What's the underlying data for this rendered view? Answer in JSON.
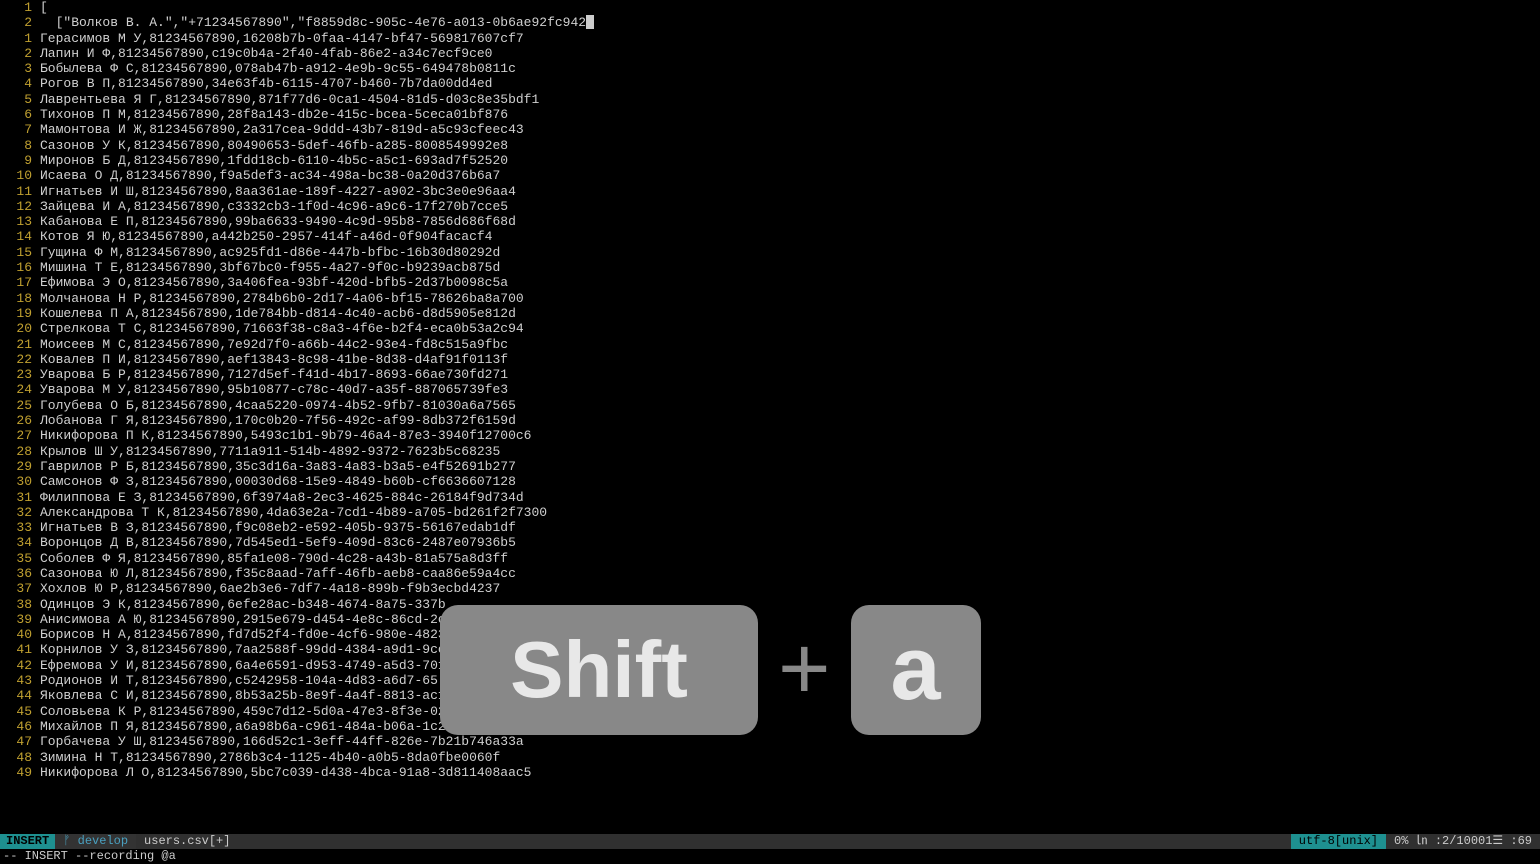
{
  "header_lines": [
    {
      "num": "1",
      "text": "["
    },
    {
      "num": "2",
      "text": "  [\"Волков В. А.\",\"+71234567890\",\"f8859d8c-905c-4e76-a013-0b6ae92fc942",
      "cursor": true
    }
  ],
  "lines": [
    {
      "num": "1",
      "text": "Герасимов М У,81234567890,16208b7b-0faa-4147-bf47-569817607cf7"
    },
    {
      "num": "2",
      "text": "Лапин И Ф,81234567890,c19c0b4a-2f40-4fab-86e2-a34c7ecf9ce0"
    },
    {
      "num": "3",
      "text": "Бобылева Ф С,81234567890,078ab47b-a912-4e9b-9c55-649478b0811c"
    },
    {
      "num": "4",
      "text": "Рогов В П,81234567890,34e63f4b-6115-4707-b460-7b7da00dd4ed"
    },
    {
      "num": "5",
      "text": "Лаврентьева Я Г,81234567890,871f77d6-0ca1-4504-81d5-d03c8e35bdf1"
    },
    {
      "num": "6",
      "text": "Тихонов П М,81234567890,28f8a143-db2e-415c-bcea-5ceca01bf876"
    },
    {
      "num": "7",
      "text": "Мамонтова И Ж,81234567890,2a317cea-9ddd-43b7-819d-a5c93cfeec43"
    },
    {
      "num": "8",
      "text": "Сазонов У К,81234567890,80490653-5def-46fb-a285-8008549992e8"
    },
    {
      "num": "9",
      "text": "Миронов Б Д,81234567890,1fdd18cb-6110-4b5c-a5c1-693ad7f52520"
    },
    {
      "num": "10",
      "text": "Исаева О Д,81234567890,f9a5def3-ac34-498a-bc38-0a20d376b6a7"
    },
    {
      "num": "11",
      "text": "Игнатьев И Ш,81234567890,8aa361ae-189f-4227-a902-3bc3e0e96aa4"
    },
    {
      "num": "12",
      "text": "Зайцева И А,81234567890,c3332cb3-1f0d-4c96-a9c6-17f270b7cce5"
    },
    {
      "num": "13",
      "text": "Кабанова Е П,81234567890,99ba6633-9490-4c9d-95b8-7856d686f68d"
    },
    {
      "num": "14",
      "text": "Котов Я Ю,81234567890,a442b250-2957-414f-a46d-0f904facacf4"
    },
    {
      "num": "15",
      "text": "Гущина Ф М,81234567890,ac925fd1-d86e-447b-bfbc-16b30d80292d"
    },
    {
      "num": "16",
      "text": "Мишина Т Е,81234567890,3bf67bc0-f955-4a27-9f0c-b9239acb875d"
    },
    {
      "num": "17",
      "text": "Ефимова Э О,81234567890,3a406fea-93bf-420d-bfb5-2d37b0098c5a"
    },
    {
      "num": "18",
      "text": "Молчанова Н Р,81234567890,2784b6b0-2d17-4a06-bf15-78626ba8a700"
    },
    {
      "num": "19",
      "text": "Кошелева П А,81234567890,1de784bb-d814-4c40-acb6-d8d5905e812d"
    },
    {
      "num": "20",
      "text": "Стрелкова Т С,81234567890,71663f38-c8a3-4f6e-b2f4-eca0b53a2c94"
    },
    {
      "num": "21",
      "text": "Моисеев М С,81234567890,7e92d7f0-a66b-44c2-93e4-fd8c515a9fbc"
    },
    {
      "num": "22",
      "text": "Ковалев П И,81234567890,aef13843-8c98-41be-8d38-d4af91f0113f"
    },
    {
      "num": "23",
      "text": "Уварова Б Р,81234567890,7127d5ef-f41d-4b17-8693-66ae730fd271"
    },
    {
      "num": "24",
      "text": "Уварова М У,81234567890,95b10877-c78c-40d7-a35f-887065739fe3"
    },
    {
      "num": "25",
      "text": "Голубева О Б,81234567890,4caa5220-0974-4b52-9fb7-81030a6a7565"
    },
    {
      "num": "26",
      "text": "Лобанова Г Я,81234567890,170c0b20-7f56-492c-af99-8db372f6159d"
    },
    {
      "num": "27",
      "text": "Никифорова П К,81234567890,5493c1b1-9b79-46a4-87e3-3940f12700c6"
    },
    {
      "num": "28",
      "text": "Крылов Ш У,81234567890,7711a911-514b-4892-9372-7623b5c68235"
    },
    {
      "num": "29",
      "text": "Гаврилов Р Б,81234567890,35c3d16a-3a83-4a83-b3a5-e4f52691b277"
    },
    {
      "num": "30",
      "text": "Самсонов Ф З,81234567890,00030d68-15e9-4849-b60b-cf6636607128"
    },
    {
      "num": "31",
      "text": "Филиппова Е З,81234567890,6f3974a8-2ec3-4625-884c-26184f9d734d"
    },
    {
      "num": "32",
      "text": "Александрова Т К,81234567890,4da63e2a-7cd1-4b89-a705-bd261f2f7300"
    },
    {
      "num": "33",
      "text": "Игнатьев В З,81234567890,f9c08eb2-e592-405b-9375-56167edab1df"
    },
    {
      "num": "34",
      "text": "Воронцов Д В,81234567890,7d545ed1-5ef9-409d-83c6-2487e07936b5"
    },
    {
      "num": "35",
      "text": "Соболев Ф Я,81234567890,85fa1e08-790d-4c28-a43b-81a575a8d3ff"
    },
    {
      "num": "36",
      "text": "Сазонова Ю Л,81234567890,f35c8aad-7aff-46fb-aeb8-caa86e59a4cc"
    },
    {
      "num": "37",
      "text": "Хохлов Ю Р,81234567890,6ae2b3e6-7df7-4a18-899b-f9b3ecbd4237"
    },
    {
      "num": "38",
      "text": "Одинцов Э К,81234567890,6efe28ac-b348-4674-8a75-337b"
    },
    {
      "num": "39",
      "text": "Анисимова А Ю,81234567890,2915e679-d454-4e8c-86cd-2c"
    },
    {
      "num": "40",
      "text": "Борисов Н А,81234567890,fd7d52f4-fd0e-4cf6-980e-4823"
    },
    {
      "num": "41",
      "text": "Корнилов У З,81234567890,7aa2588f-99dd-4384-a9d1-9cc"
    },
    {
      "num": "42",
      "text": "Ефремова У И,81234567890,6a4e6591-d953-4749-a5d3-701"
    },
    {
      "num": "43",
      "text": "Родионов И Т,81234567890,c5242958-104a-4d83-a6d7-65"
    },
    {
      "num": "44",
      "text": "Яковлева С И,81234567890,8b53a25b-8e9f-4a4f-8813-ac1"
    },
    {
      "num": "45",
      "text": "Соловьева К Р,81234567890,459c7d12-5d0a-47e3-8f3e-02"
    },
    {
      "num": "46",
      "text": "Михайлов П Я,81234567890,a6a98b6a-c961-484a-b06a-1c2"
    },
    {
      "num": "47",
      "text": "Горбачева У Ш,81234567890,166d52c1-3eff-44ff-826e-7b21b746a33a"
    },
    {
      "num": "48",
      "text": "Зимина Н Т,81234567890,2786b3c4-1125-4b40-a0b5-8da0fbe0060f"
    },
    {
      "num": "49",
      "text": "Никифорова Л О,81234567890,5bc7c039-d438-4bca-91a8-3d811408aac5"
    }
  ],
  "status": {
    "mode": "INSERT",
    "branch_symbol": "ᚠ",
    "branch": "develop",
    "file": "users.csv[+]",
    "encoding": "utf-8[unix]",
    "position": "0% ㏑ :2/10001☰ :69"
  },
  "cmdline": {
    "left": "-- INSERT --recording @a"
  },
  "overlay": {
    "key1": "Shift",
    "plus": "+",
    "key2": "a"
  }
}
